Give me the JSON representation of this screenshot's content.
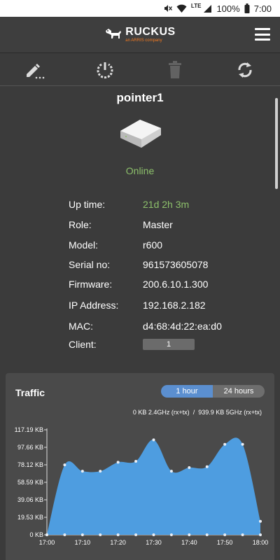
{
  "status_bar": {
    "battery": "100%",
    "time": "7:00",
    "lte": "LTE"
  },
  "app": {
    "brand": "RUCKUS",
    "sub": "an ARRIS company"
  },
  "device": {
    "name": "pointer1",
    "status": "Online",
    "info": [
      {
        "key": "Up time:",
        "value": "21d 2h 3m",
        "green": true
      },
      {
        "key": "Role:",
        "value": "Master"
      },
      {
        "key": "Model:",
        "value": "r600"
      },
      {
        "key": "Serial no:",
        "value": "961573605078"
      },
      {
        "key": "Firmware:",
        "value": "200.6.10.1.300"
      },
      {
        "key": "IP Address:",
        "value": "192.168.2.182"
      },
      {
        "key": "MAC:",
        "value": "d4:68:4d:22:ea:d0"
      },
      {
        "key": "Client:",
        "value": "1",
        "badge": true
      }
    ]
  },
  "traffic": {
    "title": "Traffic",
    "range_1h": "1 hour",
    "range_24h": "24 hours",
    "legend_24": "0 KB  2.4GHz (rx+tx)",
    "legend_sep": "/",
    "legend_5": "939.9 KB  5GHz (rx+tx)",
    "colors": {
      "fill": "#4e9de0",
      "point": "#e9eef5",
      "active": "#5b8fd0"
    }
  },
  "chart_data": {
    "type": "area",
    "x": [
      "17:00",
      "17:05",
      "17:10",
      "17:15",
      "17:20",
      "17:25",
      "17:30",
      "17:35",
      "17:40",
      "17:45",
      "17:50",
      "17:55",
      "18:00"
    ],
    "xticks": [
      "17:00",
      "17:10",
      "17:20",
      "17:30",
      "17:40",
      "17:50",
      "18:00"
    ],
    "yticks": [
      "0 KB",
      "19.53 KB",
      "39.06 KB",
      "58.59 KB",
      "78.12 KB",
      "97.66 KB",
      "117.19 KB"
    ],
    "ylim": [
      0,
      117.19
    ],
    "series": [
      {
        "values": [
          0,
          78,
          71,
          71,
          81,
          82,
          106,
          71,
          75,
          76,
          101,
          101,
          15
        ]
      }
    ]
  }
}
